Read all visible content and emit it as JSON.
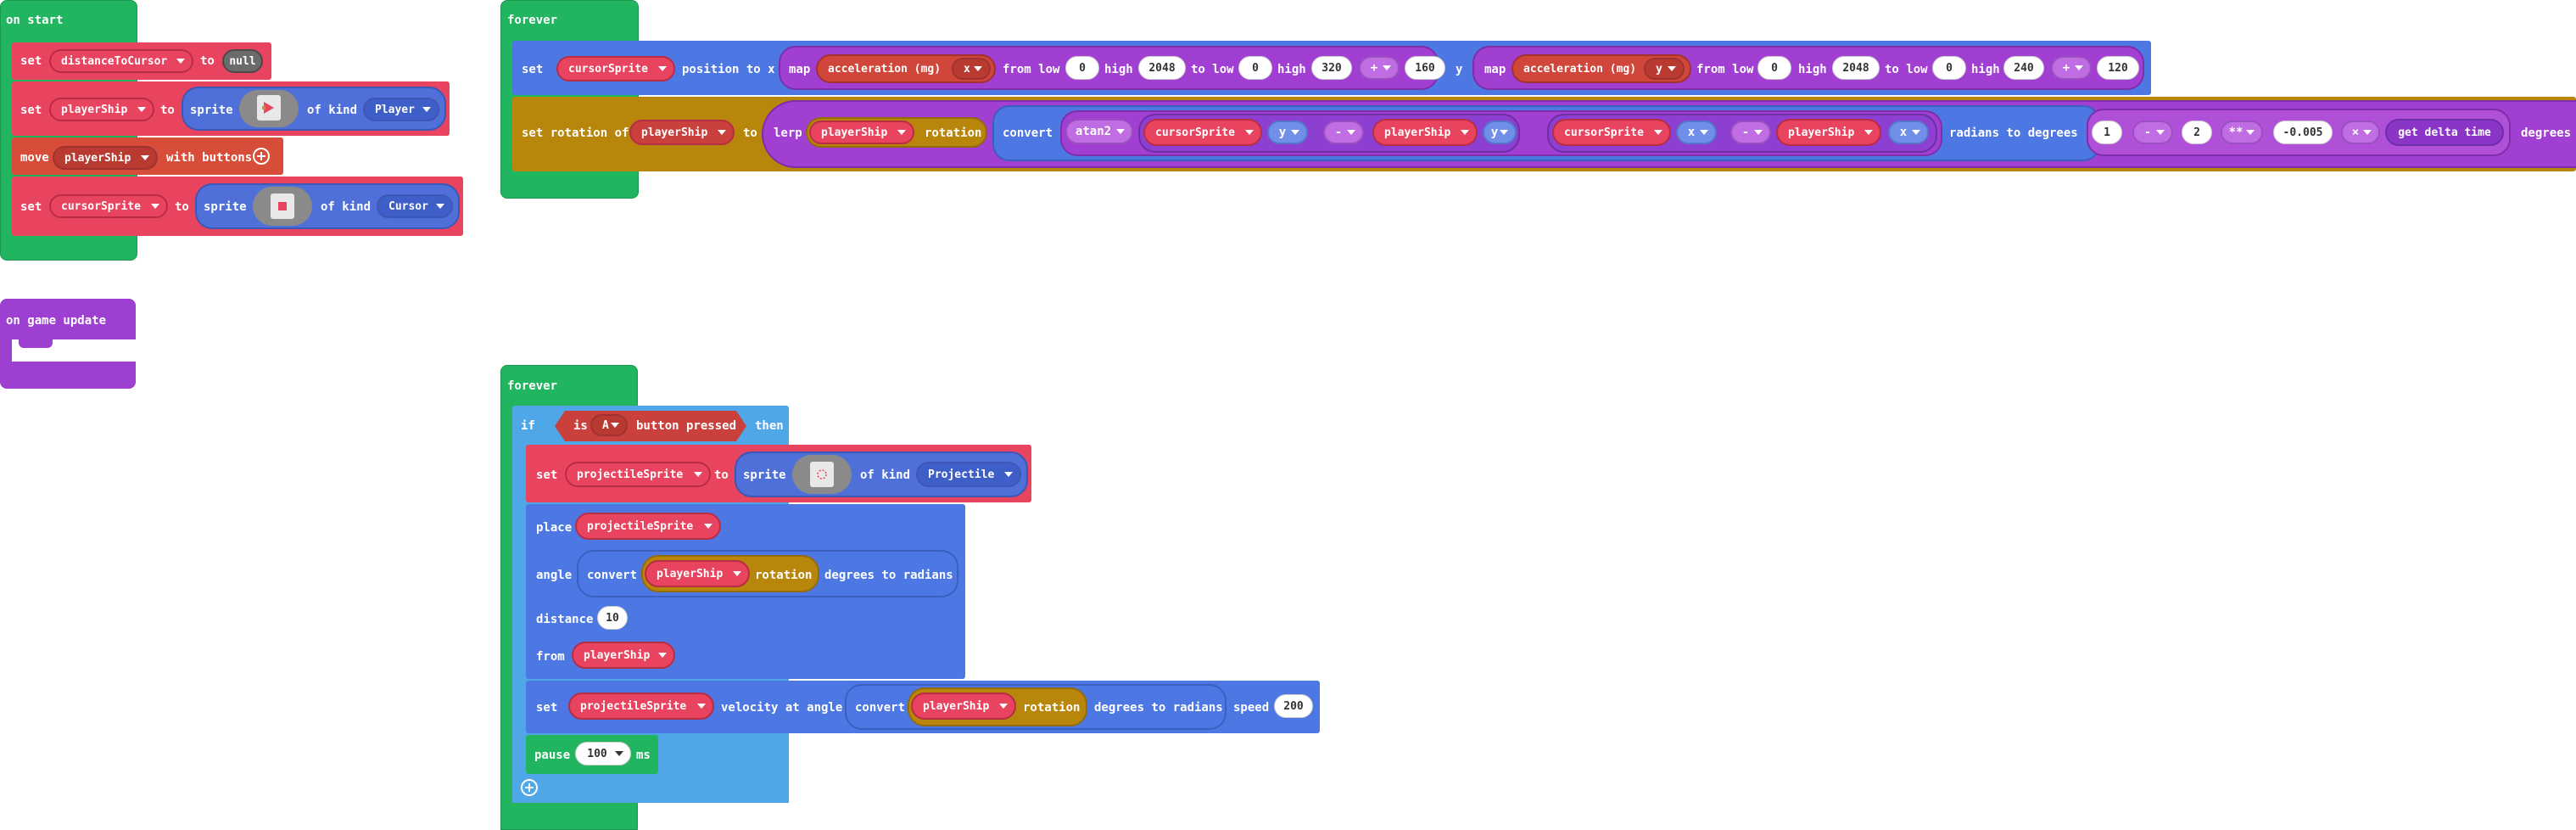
{
  "on_start": {
    "title": "on start",
    "rows": [
      {
        "kw": "set",
        "var": "distanceToCursor",
        "to": "to",
        "val": "null"
      },
      {
        "kw": "set",
        "var": "playerShip",
        "to": "to",
        "fn": "sprite",
        "of_kind": "of kind",
        "kind": "Player"
      },
      {
        "kw": "move",
        "var": "playerShip",
        "suffix": "with buttons"
      },
      {
        "kw": "set",
        "var": "cursorSprite",
        "to": "to",
        "fn": "sprite",
        "of_kind": "of kind",
        "kind": "Cursor"
      }
    ]
  },
  "on_game_update": {
    "title": "on game update"
  },
  "forever1": {
    "title": "forever",
    "row1": {
      "kw": "set",
      "var": "cursorSprite",
      "mid": "position to x",
      "map": "map",
      "accel": "acceleration (mg)",
      "ax": "x",
      "from_low": "from low",
      "v0": "0",
      "high": "high",
      "v2048": "2048",
      "to_low": "to low",
      "v0b": "0",
      "high2": "high",
      "v320": "320",
      "plus": "+",
      "v160": "160",
      "y": "y",
      "map2": "map",
      "accel2": "acceleration (mg)",
      "ay": "y",
      "from_low2": "from low",
      "w0": "0",
      "high3": "high",
      "w2048": "2048",
      "to_low2": "to low",
      "w0b": "0",
      "high4": "high",
      "w240": "240",
      "plus2": "+",
      "w120": "120"
    },
    "row2": {
      "kw": "set rotation of",
      "var": "playerShip",
      "to": "to",
      "lerp": "lerp",
      "lvar": "playerShip",
      "rot": "rotation",
      "convert": "convert",
      "atan2": "atan2",
      "cs1": "cursorSprite",
      "cy": "y",
      "minus": "-",
      "ps1": "playerShip",
      "py": "y",
      "cs2": "cursorSprite",
      "cx": "x",
      "minus2": "-",
      "ps2": "playerShip",
      "px": "x",
      "r2d": "radians to degrees",
      "n1": "1",
      "minus3": "-",
      "n2": "2",
      "pow": "**",
      "n3": "-0.005",
      "times": "×",
      "delta": "get delta time",
      "degrees": "degrees"
    }
  },
  "forever2": {
    "title": "forever",
    "if": "if",
    "is": "is",
    "btn": "A",
    "pressed": "button pressed",
    "then": "then",
    "set_kw": "set",
    "proj": "projectileSprite",
    "to": "to",
    "sprite": "sprite",
    "of_kind": "of kind",
    "kind": "Projectile",
    "place": "place",
    "proj2": "projectileSprite",
    "angle": "angle",
    "convert": "convert",
    "ps": "playerShip",
    "rotation": "rotation",
    "d2r": "degrees to radians",
    "distance": "distance",
    "dist_val": "10",
    "from": "from",
    "ps2": "playerShip",
    "set2": "set",
    "proj3": "projectileSprite",
    "vel": "velocity at angle",
    "convert2": "convert",
    "ps3": "playerShip",
    "rotation2": "rotation",
    "d2r2": "degrees to radians",
    "speed": "speed",
    "speed_val": "200",
    "pause": "pause",
    "pause_val": "100",
    "ms": "ms"
  }
}
